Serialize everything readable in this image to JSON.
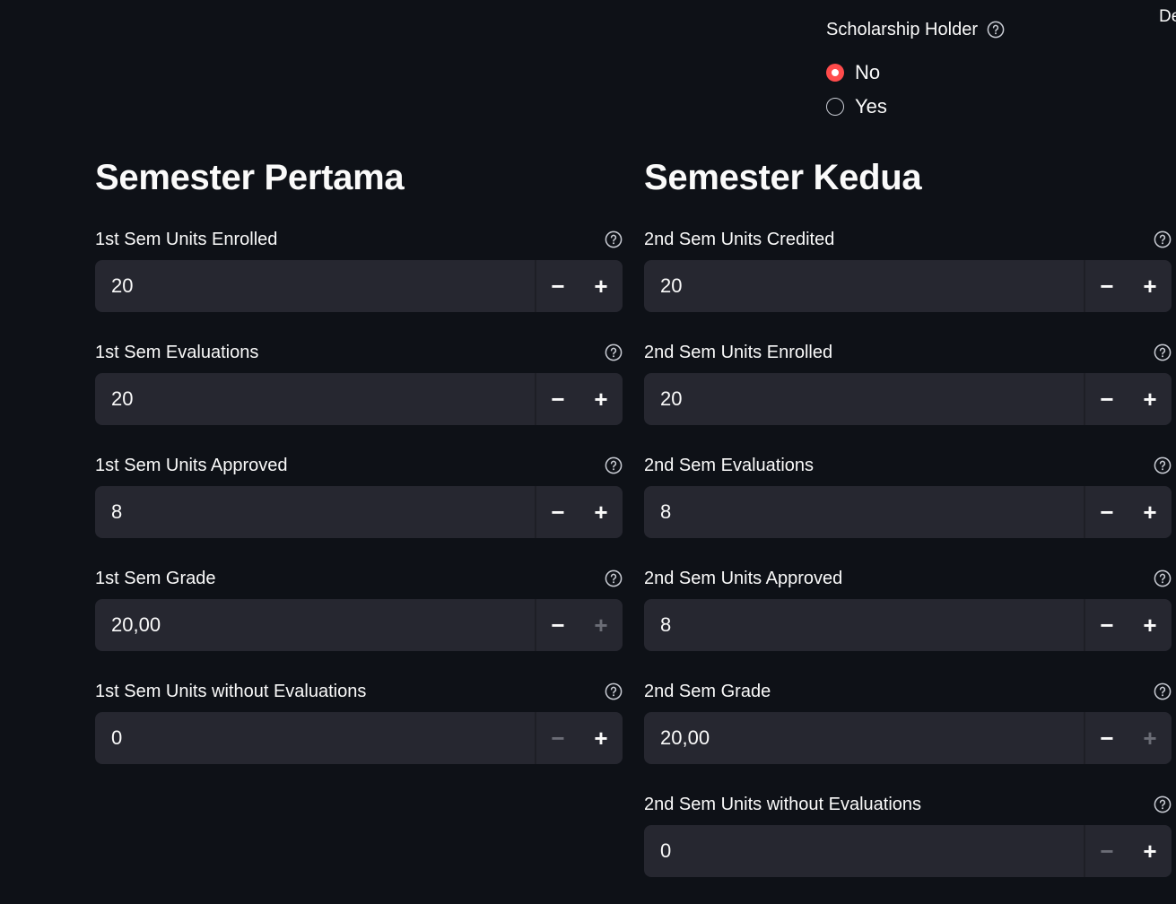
{
  "corner_text": "De",
  "scholarship": {
    "label": "Scholarship Holder",
    "options": [
      {
        "label": "No",
        "selected": true
      },
      {
        "label": "Yes",
        "selected": false
      }
    ]
  },
  "columns": [
    {
      "title": "Semester Pertama",
      "fields": [
        {
          "label": "1st Sem Units Enrolled",
          "value": "20",
          "minus_enabled": true,
          "plus_enabled": true
        },
        {
          "label": "1st Sem Evaluations",
          "value": "20",
          "minus_enabled": true,
          "plus_enabled": true
        },
        {
          "label": "1st Sem Units Approved",
          "value": "8",
          "minus_enabled": true,
          "plus_enabled": true
        },
        {
          "label": "1st Sem Grade",
          "value": "20,00",
          "minus_enabled": true,
          "plus_enabled": false
        },
        {
          "label": "1st Sem Units without Evaluations",
          "value": "0",
          "minus_enabled": false,
          "plus_enabled": true
        }
      ]
    },
    {
      "title": "Semester Kedua",
      "fields": [
        {
          "label": "2nd Sem Units Credited",
          "value": "20",
          "minus_enabled": true,
          "plus_enabled": true
        },
        {
          "label": "2nd Sem Units Enrolled",
          "value": "20",
          "minus_enabled": true,
          "plus_enabled": true
        },
        {
          "label": "2nd Sem Evaluations",
          "value": "8",
          "minus_enabled": true,
          "plus_enabled": true
        },
        {
          "label": "2nd Sem Units Approved",
          "value": "8",
          "minus_enabled": true,
          "plus_enabled": true
        },
        {
          "label": "2nd Sem Grade",
          "value": "20,00",
          "minus_enabled": true,
          "plus_enabled": false
        },
        {
          "label": "2nd Sem Units without Evaluations",
          "value": "0",
          "minus_enabled": false,
          "plus_enabled": true
        }
      ]
    }
  ],
  "stepper": {
    "minus_symbol": "−",
    "plus_symbol": "+"
  },
  "colors": {
    "background": "#0e1117",
    "input_bg": "#262730",
    "accent": "#ff4b4b",
    "text": "#fafafa",
    "disabled": "#6b6d76"
  },
  "icons": {
    "help": "help-circle-icon"
  }
}
